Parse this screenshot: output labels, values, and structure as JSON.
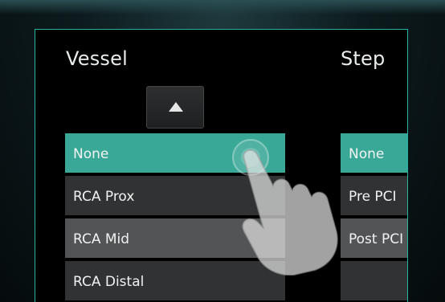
{
  "vessel": {
    "title": "Vessel",
    "items": [
      {
        "label": "None",
        "selected": true
      },
      {
        "label": "RCA Prox",
        "selected": false
      },
      {
        "label": "RCA Mid",
        "selected": false
      },
      {
        "label": "RCA Distal",
        "selected": false
      }
    ]
  },
  "step": {
    "title": "Step",
    "items": [
      {
        "label": "None",
        "selected": true
      },
      {
        "label": "Pre PCI",
        "selected": false
      },
      {
        "label": "Post PCI",
        "selected": false
      },
      {
        "label": "",
        "selected": false
      }
    ]
  },
  "icons": {
    "scroll_up": "triangle-up-icon",
    "cursor": "hand-pointer-icon"
  },
  "colors": {
    "accent": "#3aa897",
    "panel_border": "#2bb3a1"
  }
}
